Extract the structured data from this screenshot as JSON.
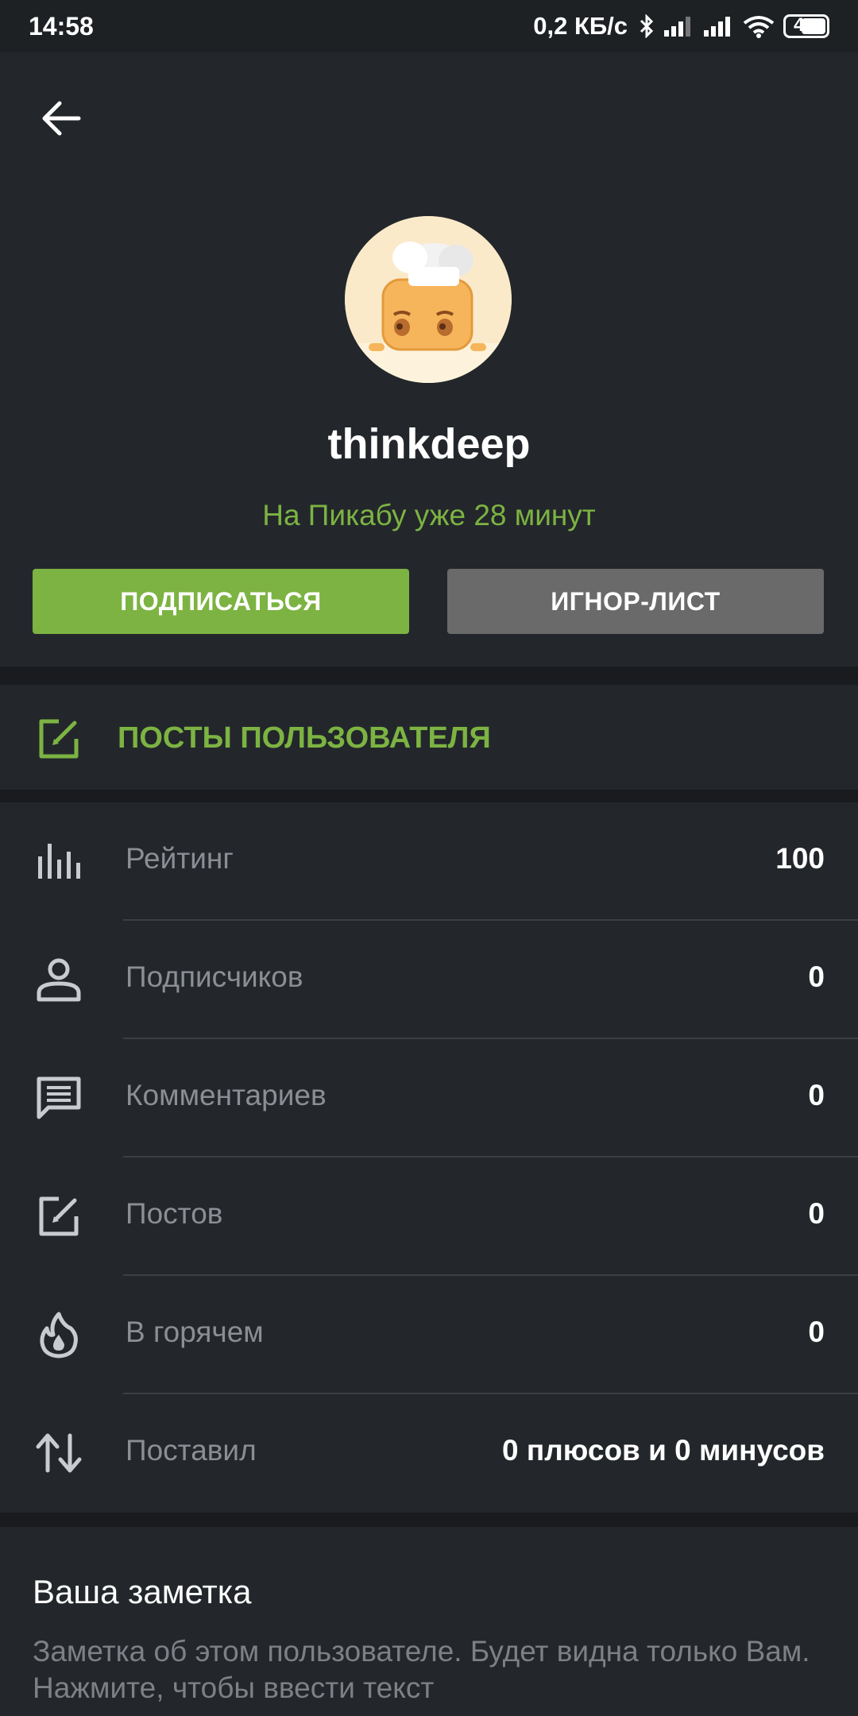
{
  "status_bar": {
    "time": "14:58",
    "net_speed": "0,2 КБ/с",
    "battery": "4"
  },
  "profile": {
    "username": "thinkdeep",
    "since": "На Пикабу уже 28 минут",
    "subscribe_label": "ПОДПИСАТЬСЯ",
    "ignore_label": "ИГНОР-ЛИСТ"
  },
  "posts_link": {
    "label": "ПОСТЫ ПОЛЬЗОВАТЕЛЯ"
  },
  "stats": [
    {
      "icon": "bar-chart-icon",
      "label": "Рейтинг",
      "value": "100"
    },
    {
      "icon": "person-icon",
      "label": "Подписчиков",
      "value": "0"
    },
    {
      "icon": "comment-icon",
      "label": "Комментариев",
      "value": "0"
    },
    {
      "icon": "edit-icon",
      "label": "Постов",
      "value": "0"
    },
    {
      "icon": "flame-icon",
      "label": "В горячем",
      "value": "0"
    },
    {
      "icon": "swap-vertical-icon",
      "label": "Поставил",
      "value": "0 плюсов и 0 минусов"
    }
  ],
  "note": {
    "title": "Ваша заметка",
    "placeholder": "Заметка об этом пользователе. Будет видна только Вам. Нажмите, чтобы ввести текст"
  },
  "colors": {
    "accent": "#7cb342",
    "background": "#23272b",
    "separator": "#191b1e",
    "ignore_button": "#6a6a6a"
  }
}
